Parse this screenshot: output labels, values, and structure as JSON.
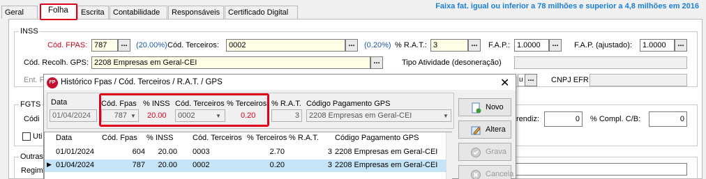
{
  "tabs": [
    "Geral",
    "Folha",
    "Escrita",
    "Contabilidade",
    "Responsáveis",
    "Certificado Digital"
  ],
  "active_tab": "Folha",
  "headline": "Faixa fat. igual ou inferior a 78 milhões e superior a 4,8 milhões em 2016",
  "inss": {
    "group_title": "INSS",
    "fpas_label": "Cód. FPAS:",
    "fpas_value": "787",
    "fpas_pct": "(20.00%)",
    "terceiros_label": "Cód. Terceiros:",
    "terceiros_value": "0002",
    "terceiros_pct": "(0.20%)",
    "rat_label": "% R.A.T.:",
    "rat_value": "3",
    "fap_label": "F.A.P.:",
    "fap_value": "1.0000",
    "fap_aj_label": "F.A.P. (ajustado):",
    "fap_aj_value": "1.0000",
    "gps_label": "Cód. Recolh. GPS:",
    "gps_value": "2208 Empresas em Geral-CEI",
    "tipo_label": "Tipo Atividade (desoneração)",
    "ent_label": "Ent. F",
    "cnpj_label": "CNPJ EFR",
    "dots": "..."
  },
  "fgts": {
    "group_title": "FGTS",
    "cod_label": "Códi",
    "uti_label": "Uti",
    "aprendiz_label": "rendiz:",
    "aprendiz_value": "0",
    "compl_label": "% Compl. C/B:",
    "compl_value": "0"
  },
  "outras": {
    "group_title": "Outras",
    "regime_label": "Regim"
  },
  "dialog": {
    "title": "Histórico Fpas / Cód. Terceiros / R.A.T. / GPS",
    "icon_text": "FP",
    "close": "✕",
    "edit": {
      "data_label": "Data",
      "data_value": "01/04/2024",
      "fpas_label": "Cód. Fpas",
      "fpas_value": "787",
      "inss_label": "% INSS",
      "inss_value": "20.00",
      "terceiros_label": "Cód. Terceiros",
      "terceiros_value": "0002",
      "pct_terc_label": "% Terceiros",
      "pct_terc_value": "0.20",
      "rat_label": "% R.A.T.",
      "rat_value": "3",
      "gps_label": "Código Pagamento GPS",
      "gps_value": "2208 Empresas em Geral-CEI"
    },
    "grid": {
      "headers": [
        "Data",
        "Cód. Fpas",
        "% INSS",
        "Cód. Terceiros",
        "% Terceiros",
        "% R.A.T.",
        "Código Pagamento GPS"
      ],
      "rows": [
        [
          "01/01/2024",
          "604",
          "20.00",
          "0003",
          "2.70",
          "3",
          "2208 Empresas em Geral-CEI"
        ],
        [
          "01/04/2024",
          "787",
          "20.00",
          "0002",
          "0.20",
          "3",
          "2208 Empresas em Geral-CEI"
        ]
      ],
      "selected_marker": "▶"
    },
    "buttons": {
      "novo": "Novo",
      "altera": "Altera",
      "grava": "Grava",
      "cancela": "Cancela"
    }
  }
}
